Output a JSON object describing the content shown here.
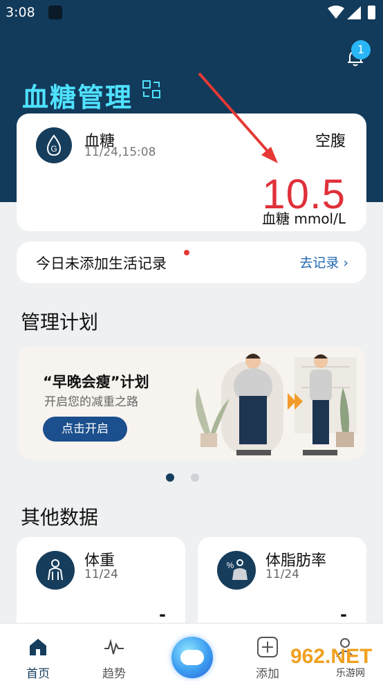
{
  "status_bar": {
    "time": "3:08"
  },
  "header": {
    "title": "血糖管理",
    "notification_count": "1"
  },
  "glucose_card": {
    "title": "血糖",
    "datetime": "11/24,15:08",
    "status": "空腹",
    "value": "10.5",
    "unit": "血糖 mmol/L",
    "icon_letter": "G",
    "value_color": "#e0303a"
  },
  "record_bar": {
    "text": "今日未添加生活记录",
    "link": "去记录",
    "link_chevron": "›"
  },
  "plan_section": {
    "title": "管理计划",
    "banner": {
      "heading": "“早晚会瘦”计划",
      "subtitle": "开启您的减重之路",
      "button": "点击开启"
    },
    "carousel_active_index": 0,
    "carousel_count": 2
  },
  "other_section": {
    "title": "其他数据",
    "cards": [
      {
        "title": "体重",
        "date": "11/24",
        "value": "-",
        "icon": "person-icon"
      },
      {
        "title": "体脂肪率",
        "date": "11/24",
        "value": "-",
        "icon": "body-fat-icon",
        "icon_text": "%"
      }
    ]
  },
  "bottom_nav": {
    "items": [
      {
        "label": "首页",
        "icon": "home-icon",
        "active": true
      },
      {
        "label": "趋势",
        "icon": "trend-icon",
        "active": false
      },
      {
        "label": "",
        "icon": "chat-bubble-icon",
        "active": false
      },
      {
        "label": "添加",
        "icon": "add-icon",
        "active": false
      },
      {
        "label": "",
        "icon": "profile-icon",
        "active": false
      }
    ]
  },
  "watermark": {
    "text": "962.NET",
    "subtext": "乐游网"
  },
  "colors": {
    "header": "#123a5a",
    "title_accent": "#4fe2ff",
    "link": "#1f67b1",
    "button": "#1c4f8d",
    "badge": "#29b6f6",
    "annotation_arrow": "#e53935"
  }
}
